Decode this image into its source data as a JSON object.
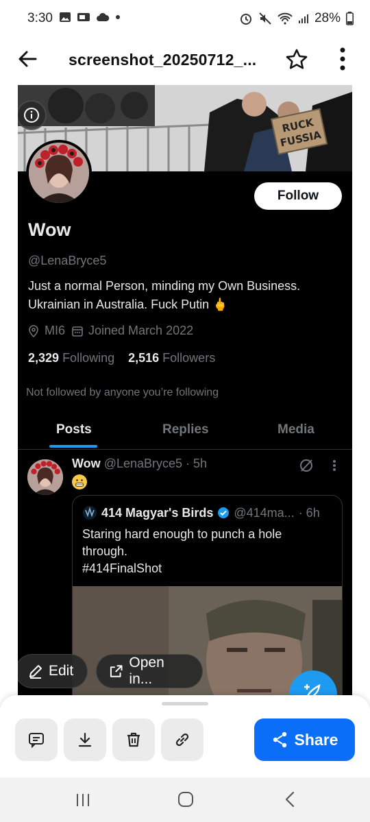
{
  "status_bar": {
    "time": "3:30",
    "battery": "28%"
  },
  "app_bar": {
    "title": "screenshot_20250712_..."
  },
  "profile": {
    "follow_label": "Follow",
    "name": "Wow",
    "handle": "@LenaBryce5",
    "bio_line1": "Just a normal Person, minding my Own Business.",
    "bio_line2": "Ukrainian in Australia. Fuck Putin 🖕",
    "location": "MI6",
    "joined": "Joined March 2022",
    "following_count": "2,329",
    "following_label": "Following",
    "followers_count": "2,516",
    "followers_label": "Followers",
    "not_followed": "Not followed by anyone you’re following",
    "banner_sign": "RUCK\nFUSSIA"
  },
  "tabs": [
    {
      "label": "Posts",
      "active": true
    },
    {
      "label": "Replies",
      "active": false
    },
    {
      "label": "Media",
      "active": false
    }
  ],
  "post": {
    "name": "Wow",
    "handle": "@LenaBryce5",
    "age": "· 5h",
    "quote": {
      "name": "414 Magyar's Birds",
      "handle": "@414ma...",
      "age": "· 6h",
      "text_line1": "Staring hard enough to punch a hole",
      "text_line2": "through.",
      "hashtag": "#414FinalShot"
    }
  },
  "overlay": {
    "edit_label": "Edit",
    "open_label": "Open in..."
  },
  "sheet": {
    "share_label": "Share",
    "actions": [
      "comment-icon",
      "download-icon",
      "trash-icon",
      "link-icon"
    ]
  },
  "colors": {
    "accent": "#1d9bf0",
    "share": "#0b6ef8",
    "dark_bg": "#000000"
  }
}
